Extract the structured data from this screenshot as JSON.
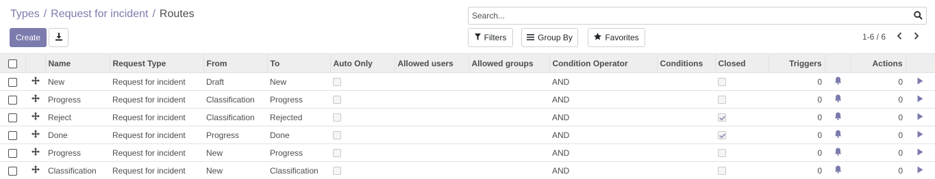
{
  "breadcrumb": {
    "items": [
      "Types",
      "Request for incident"
    ],
    "current": "Routes",
    "separator": "/"
  },
  "toolbar": {
    "create_label": "Create",
    "download_icon": "download-icon"
  },
  "search": {
    "placeholder": "Search...",
    "icon": "search-icon"
  },
  "filters": {
    "filters_label": "Filters",
    "group_by_label": "Group By",
    "favorites_label": "Favorites"
  },
  "pager": {
    "text": "1-6 / 6"
  },
  "colors": {
    "accent": "#7c7bad",
    "header_bg": "#eeeeee"
  },
  "table": {
    "columns": [
      "Name",
      "Request Type",
      "From",
      "To",
      "Auto Only",
      "Allowed users",
      "Allowed groups",
      "Condition Operator",
      "Conditions",
      "Closed",
      "Triggers",
      "Actions"
    ],
    "rows": [
      {
        "name": "New",
        "request_type": "Request for incident",
        "from": "Draft",
        "to": "New",
        "auto_only": false,
        "allowed_users": "",
        "allowed_groups": "",
        "condition_operator": "AND",
        "conditions": "",
        "closed": false,
        "triggers": "0",
        "actions": "0"
      },
      {
        "name": "Progress",
        "request_type": "Request for incident",
        "from": "Classification",
        "to": "Progress",
        "auto_only": false,
        "allowed_users": "",
        "allowed_groups": "",
        "condition_operator": "AND",
        "conditions": "",
        "closed": false,
        "triggers": "0",
        "actions": "0"
      },
      {
        "name": "Reject",
        "request_type": "Request for incident",
        "from": "Classification",
        "to": "Rejected",
        "auto_only": false,
        "allowed_users": "",
        "allowed_groups": "",
        "condition_operator": "AND",
        "conditions": "",
        "closed": true,
        "triggers": "0",
        "actions": "0"
      },
      {
        "name": "Done",
        "request_type": "Request for incident",
        "from": "Progress",
        "to": "Done",
        "auto_only": false,
        "allowed_users": "",
        "allowed_groups": "",
        "condition_operator": "AND",
        "conditions": "",
        "closed": true,
        "triggers": "0",
        "actions": "0"
      },
      {
        "name": "Progress",
        "request_type": "Request for incident",
        "from": "New",
        "to": "Progress",
        "auto_only": false,
        "allowed_users": "",
        "allowed_groups": "",
        "condition_operator": "AND",
        "conditions": "",
        "closed": false,
        "triggers": "0",
        "actions": "0"
      },
      {
        "name": "Classification",
        "request_type": "Request for incident",
        "from": "New",
        "to": "Classification",
        "auto_only": false,
        "allowed_users": "",
        "allowed_groups": "",
        "condition_operator": "AND",
        "conditions": "",
        "closed": false,
        "triggers": "0",
        "actions": "0"
      }
    ]
  }
}
